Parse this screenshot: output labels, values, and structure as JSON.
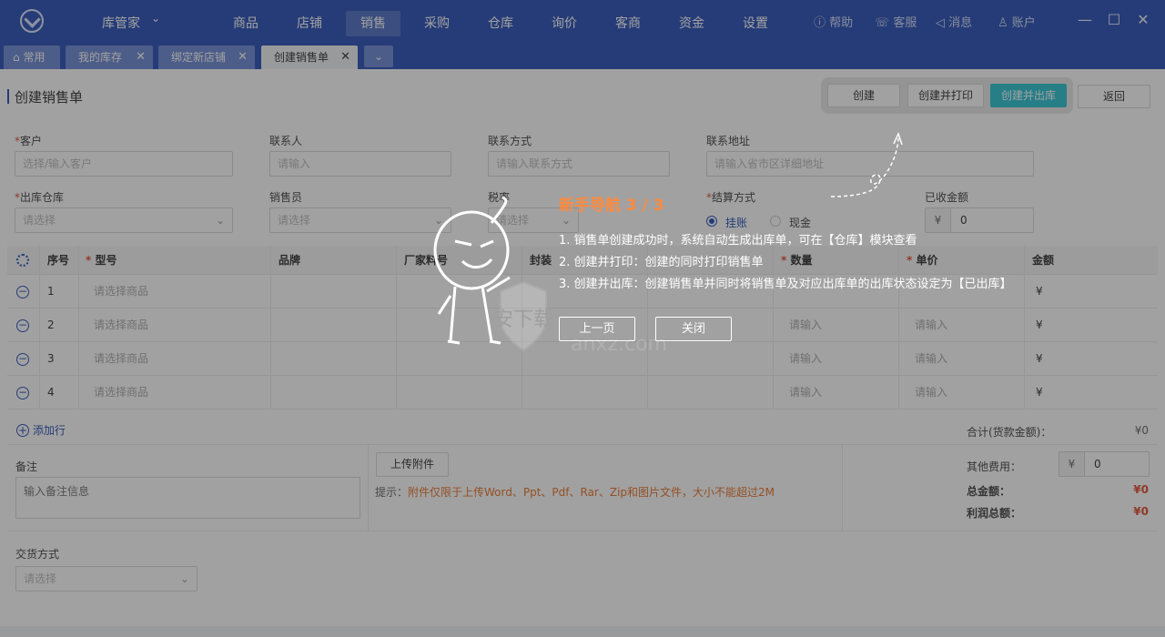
{
  "topbar": {
    "app_name": "库管家",
    "nav": [
      "商品",
      "店铺",
      "销售",
      "采购",
      "仓库",
      "询价",
      "客商",
      "资金",
      "设置"
    ],
    "active_nav": "销售",
    "help": "帮助",
    "service": "客服",
    "messages": "消息",
    "account": "账户"
  },
  "tabs": [
    {
      "label": "常用"
    },
    {
      "label": "我的库存"
    },
    {
      "label": "绑定新店铺"
    },
    {
      "label": "创建销售单"
    }
  ],
  "page": {
    "title": "创建销售单",
    "actions": {
      "create": "创建",
      "create_print": "创建并打印",
      "create_out": "创建并出库",
      "back": "返回"
    }
  },
  "form": {
    "customer": {
      "label": "客户",
      "placeholder": "选择/输入客户"
    },
    "contact": {
      "label": "联系人",
      "placeholder": "请输入"
    },
    "phone": {
      "label": "联系方式",
      "placeholder": "请输入联系方式"
    },
    "address": {
      "label": "联系地址",
      "placeholder": "请输入省市区详细地址"
    },
    "warehouse": {
      "label": "出库仓库",
      "placeholder": "请选择"
    },
    "salesman": {
      "label": "销售员",
      "placeholder": "请选择"
    },
    "tax": {
      "label": "税率",
      "placeholder": "请选择"
    },
    "settlement": {
      "label": "结算方式",
      "option1": "挂账",
      "option2": "现金"
    },
    "received": {
      "label": "已收金额",
      "currency": "¥",
      "value": "0"
    }
  },
  "table": {
    "headers": {
      "index": "序号",
      "model": "型号",
      "brand": "品牌",
      "factory_no": "厂家料号",
      "package": "封装",
      "qty": "数量",
      "price": "单价",
      "amount": "金额"
    },
    "rows": [
      {
        "index": "1",
        "model": "请选择商品",
        "qty": "",
        "price": "",
        "amount": "¥"
      },
      {
        "index": "2",
        "model": "请选择商品",
        "qty": "请输入",
        "price": "请输入",
        "amount": "¥"
      },
      {
        "index": "3",
        "model": "请选择商品",
        "qty": "请输入",
        "price": "请输入",
        "amount": "¥"
      },
      {
        "index": "4",
        "model": "请选择商品",
        "qty": "请输入",
        "price": "请输入",
        "amount": "¥"
      }
    ],
    "add_row": "添加行"
  },
  "summary": {
    "subtotal_label": "合计(货款金额)：",
    "subtotal": "¥0",
    "other_fee_label": "其他费用：",
    "other_fee_currency": "¥",
    "other_fee": "0",
    "total_label": "总金额：",
    "total": "¥0",
    "profit_label": "利润总额：",
    "profit": "¥0"
  },
  "remark": {
    "label": "备注",
    "placeholder": "输入备注信息"
  },
  "upload": {
    "button": "上传附件",
    "hint_prefix": "提示：",
    "hint": "附件仅限于上传Word、Ppt、Pdf、Rar、Zip和图片文件，大小不能超过2M"
  },
  "delivery": {
    "label": "交货方式",
    "placeholder": "请选择"
  },
  "guide": {
    "title": "新手导航  3 / 3",
    "lines": [
      "1. 销售单创建成功时，系统自动生成出库单，可在【仓库】模块查看",
      "2. 创建并打印：创建的同时打印销售单",
      "3. 创建并出库：创建销售单并同时将销售单及对应出库单的出库状态设定为【已出库】"
    ],
    "prev": "上一页",
    "close": "关闭"
  },
  "watermark": {
    "text": "安下载",
    "domain": "anxz.com"
  },
  "colors": {
    "primary": "#2c52b8",
    "accent": "#2bc3d3",
    "warning": "#ff8a3d",
    "danger": "#e34d2f"
  }
}
